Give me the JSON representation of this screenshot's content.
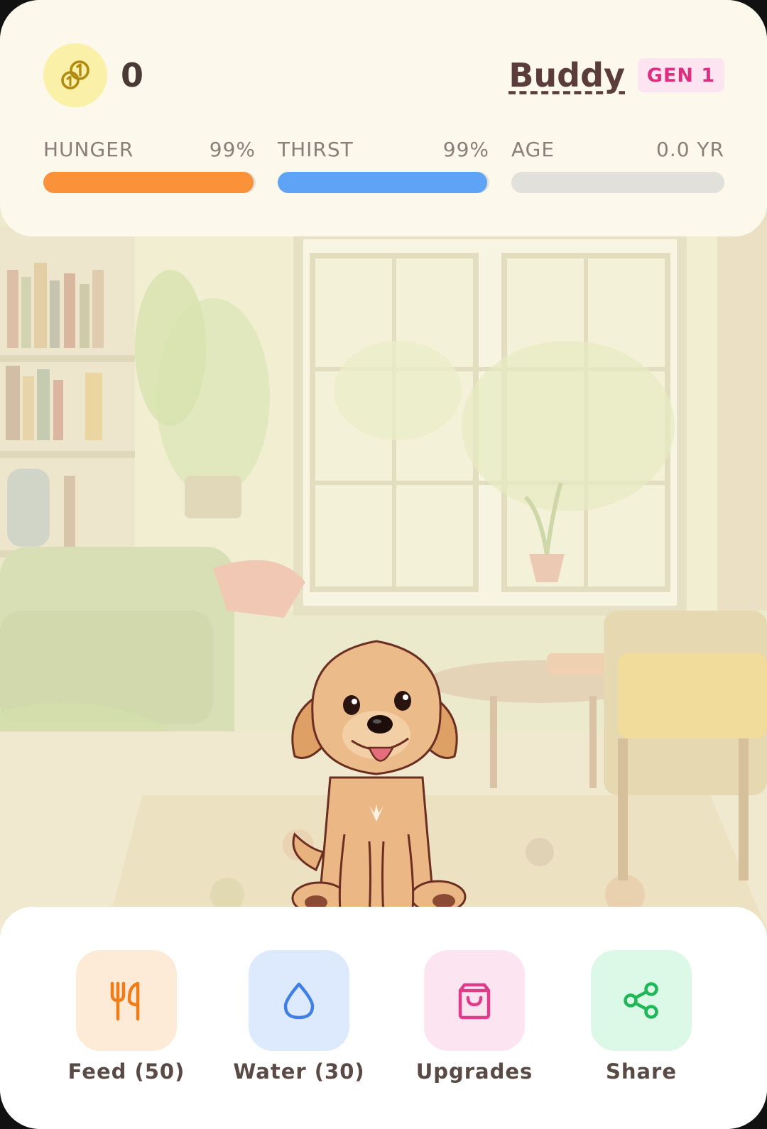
{
  "header": {
    "coins": "0",
    "pet_name": "Buddy",
    "generation": "GEN 1",
    "stats": [
      {
        "label": "HUNGER",
        "value_text": "99%",
        "fill": 0.99,
        "color": "#fb9138"
      },
      {
        "label": "THIRST",
        "value_text": "99%",
        "fill": 0.99,
        "color": "#5ea3f5"
      },
      {
        "label": "AGE",
        "value_text": "0.0 YR",
        "fill": 0.0,
        "color": "#c8c3bd"
      }
    ]
  },
  "actions": [
    {
      "label": "Feed (50)",
      "icon": "utensils-icon",
      "bg": "#fdebd7",
      "fg": "#f07d1a"
    },
    {
      "label": "Water (30)",
      "icon": "water-drop-icon",
      "bg": "#dde9fd",
      "fg": "#3f7fe6"
    },
    {
      "label": "Upgrades",
      "icon": "shopping-bag-icon",
      "bg": "#fce4f0",
      "fg": "#df3d8c"
    },
    {
      "label": "Share",
      "icon": "share-icon",
      "bg": "#dbf9e6",
      "fg": "#1fb758"
    }
  ]
}
